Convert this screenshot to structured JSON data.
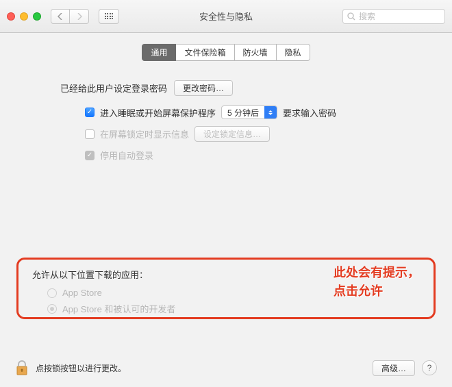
{
  "titlebar": {
    "title": "安全性与隐私",
    "search_placeholder": "搜索"
  },
  "tabs": {
    "general": "通用",
    "filevault": "文件保险箱",
    "firewall": "防火墙",
    "privacy": "隐私"
  },
  "password": {
    "set_label": "已经给此用户设定登录密码",
    "change_button": "更改密码…",
    "require_checkbox": "进入睡眠或开始屏幕保护程序",
    "delay_value": "5 分钟后",
    "require_suffix": "要求输入密码",
    "show_message_checkbox": "在屏幕锁定时显示信息",
    "set_lock_message_button": "设定锁定信息…",
    "disable_auto_login": "停用自动登录"
  },
  "download": {
    "title": "允许从以下位置下载的应用：",
    "opt_appstore": "App Store",
    "opt_identified": "App Store 和被认可的开发者"
  },
  "annotation": {
    "line1": "此处会有提示，",
    "line2": "点击允许"
  },
  "footer": {
    "lock_text": "点按锁按钮以进行更改。",
    "advanced_button": "高级…",
    "help": "?"
  }
}
